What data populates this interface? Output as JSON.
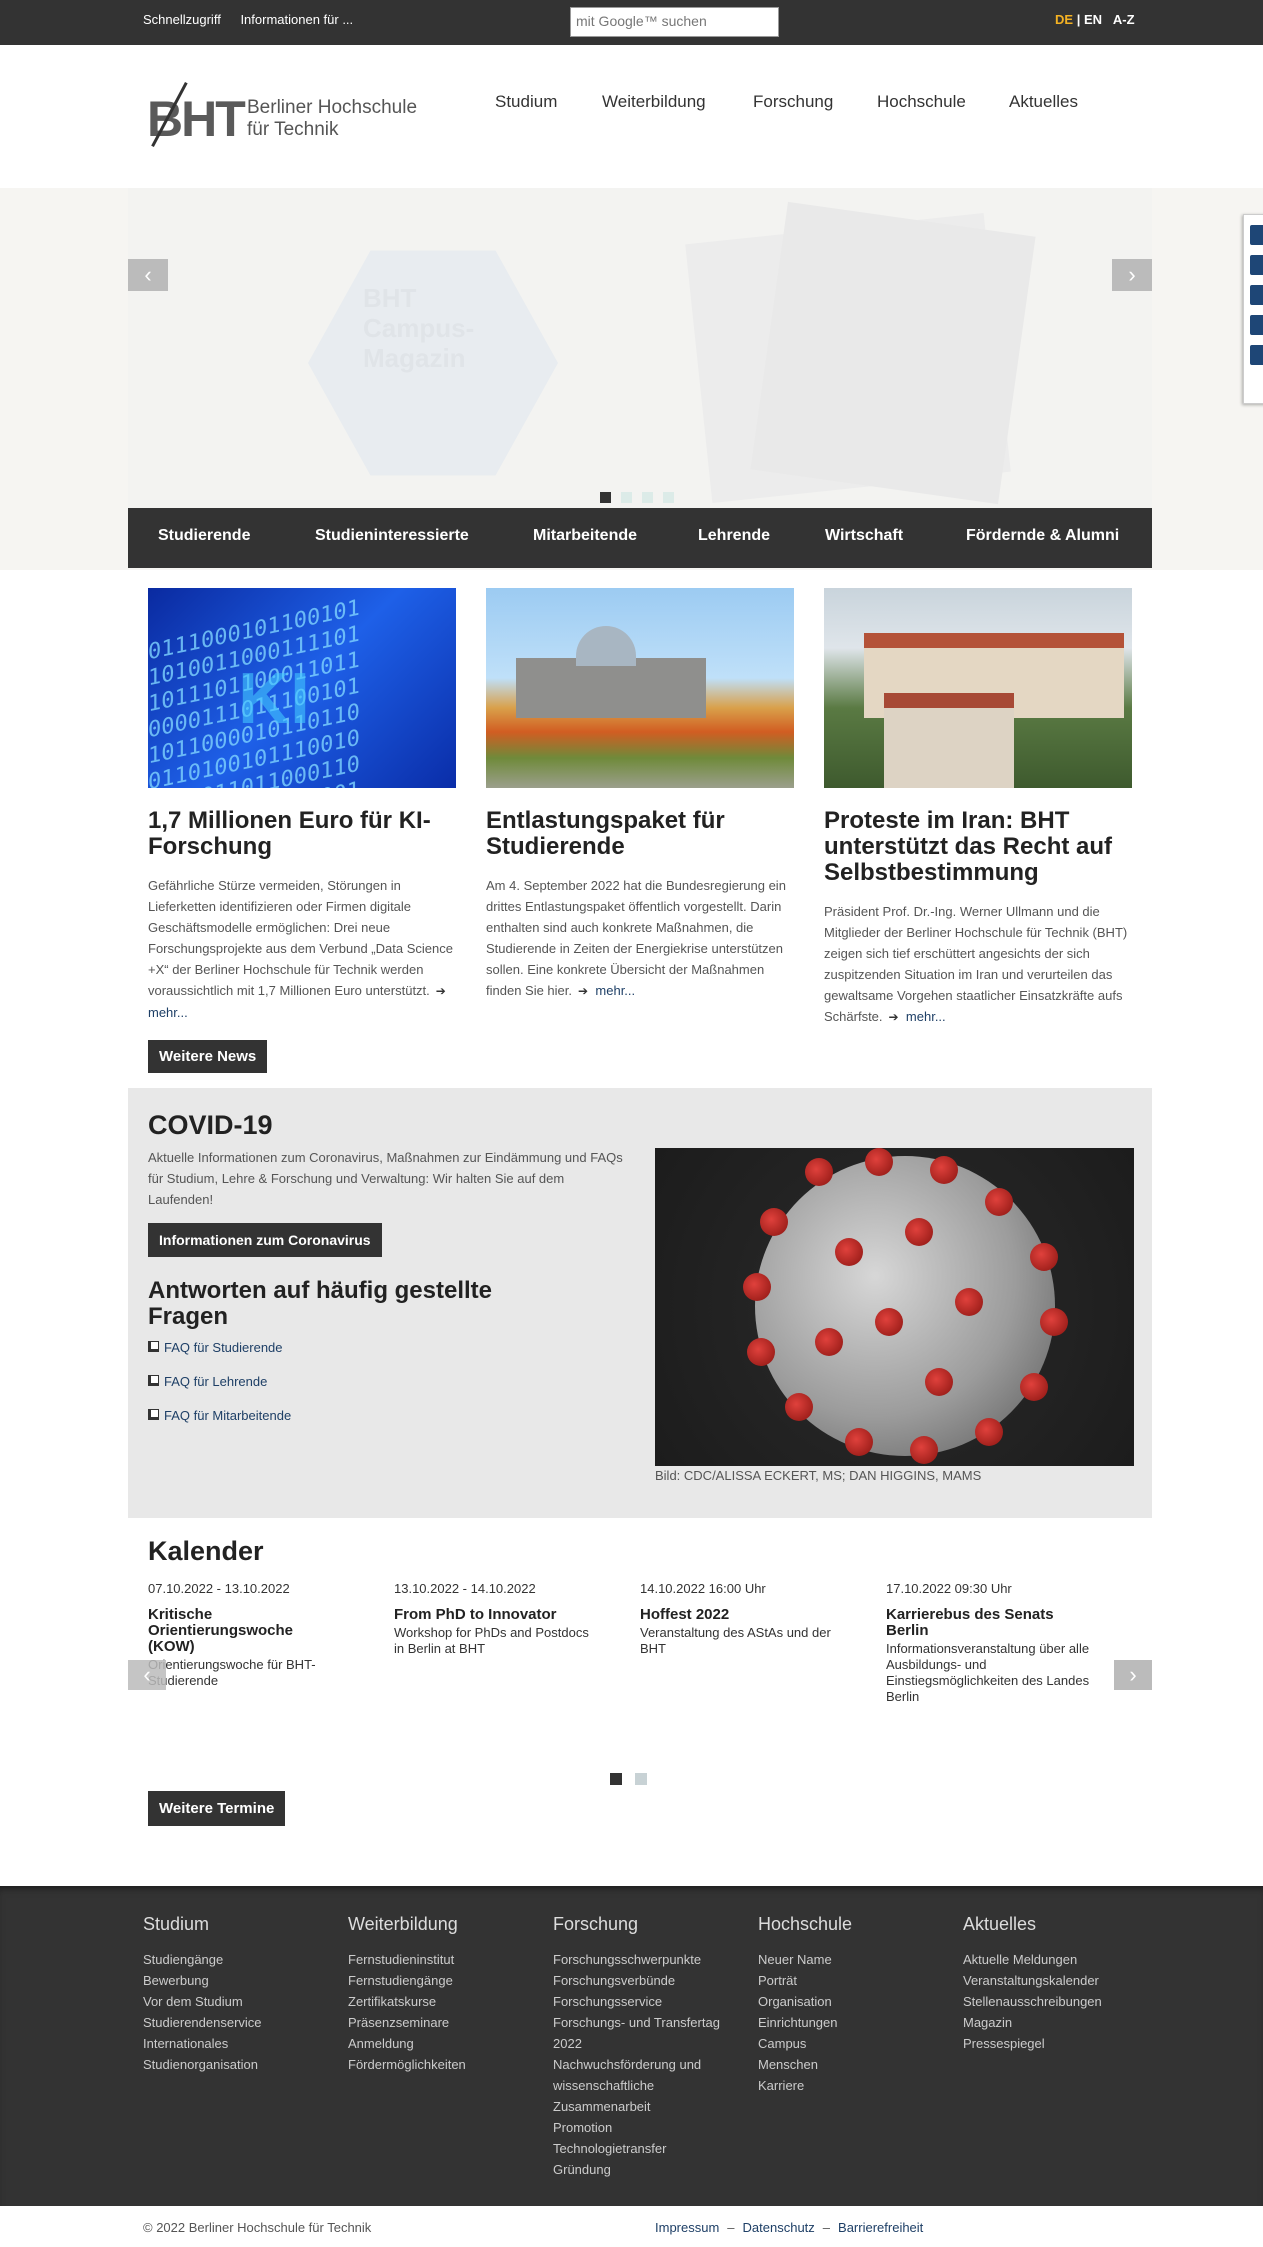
{
  "topbar": {
    "quick_access": "Schnellzugriff",
    "info_for": "Informationen für ...",
    "search_placeholder": "mit Google™ suchen",
    "lang_de": "DE",
    "lang_sep": "|",
    "lang_en": "EN",
    "az": "A-Z",
    "accent_color": "#f4b223"
  },
  "header": {
    "logo_mark": "BHT",
    "logo_line1": "Berliner Hochschule",
    "logo_line2": "für Technik",
    "nav": [
      "Studium",
      "Weiterbildung",
      "Forschung",
      "Hochschule",
      "Aktuelles"
    ]
  },
  "hero": {
    "slide_text": "BHT Campus-Magazin",
    "prev_icon": "‹",
    "next_icon": "›",
    "dot_count": 4,
    "active_dot": 1
  },
  "audience_nav": [
    "Studierende",
    "Studieninteressierte",
    "Mitarbeitende",
    "Lehrende",
    "Wirtschaft",
    "Fördernde & Alumni"
  ],
  "news": {
    "items": [
      {
        "title": "1,7 Millionen Euro für KI-Forschung",
        "text": "Gefährliche Stürze vermeiden, Störungen in Lieferketten identifizieren oder Firmen digitale Geschäftsmodelle ermöglichen: Drei neue Forschungsprojekte aus dem Verbund „Data Science +X“ der Berliner Hochschule für Technik werden voraussichtlich mit 1,7 Millionen Euro unterstützt.",
        "more": "mehr..."
      },
      {
        "title": "Entlastungspaket für Studierende",
        "text": "Am 4. September 2022 hat die Bundesregierung ein drittes Entlastungspaket öffentlich vorgestellt. Darin enthalten sind auch konkrete Maßnahmen, die Studierende in Zeiten der Energiekrise unterstützen sollen. Eine konkrete Übersicht der Maßnahmen finden Sie hier.",
        "more": "mehr..."
      },
      {
        "title": "Proteste im Iran: BHT unterstützt das Recht auf Selbstbestimmung",
        "text": "Präsident Prof. Dr.-Ing. Werner Ullmann und die Mitglieder der Berliner Hochschule für Technik (BHT) zeigen sich tief erschüttert angesichts der sich zuspitzenden Situation im Iran und verurteilen das gewaltsame Vorgehen staatlicher Einsatzkräfte aufs Schärfste.",
        "more": "mehr..."
      }
    ],
    "more_news_button": "Weitere News"
  },
  "covid": {
    "title": "COVID-19",
    "text": "Aktuelle Informationen zum Coronavirus, Maßnahmen zur Eindämmung und FAQs für Studium, Lehre & Forschung und Verwaltung: Wir halten Sie auf dem Laufenden!",
    "button": "Informationen zum Coronavirus",
    "faq_title": "Antworten auf häufig gestellte Fragen",
    "faq_links": [
      "FAQ für Studierende",
      "FAQ für Lehrende",
      "FAQ für Mitarbeitende"
    ],
    "image_credit": "Bild: CDC/ALISSA ECKERT, MS; DAN HIGGINS, MAMS"
  },
  "calendar": {
    "title": "Kalender",
    "events": [
      {
        "date": "07.10.2022 - 13.10.2022",
        "title": "Kritische Orientierungswoche (KOW)",
        "desc": "Orientierungswoche für BHT-Studierende"
      },
      {
        "date": "13.10.2022 - 14.10.2022",
        "title": "From PhD to Innovator",
        "desc": "Workshop for PhDs and Postdocs in Berlin at BHT"
      },
      {
        "date": "14.10.2022 16:00 Uhr",
        "title": "Hoffest 2022",
        "desc": "Veranstaltung des AStAs und der BHT"
      },
      {
        "date": "17.10.2022 09:30 Uhr",
        "title": "Karrierebus des Senats Berlin",
        "desc": "Informationsveranstaltung über alle Ausbildungs- und Einstiegsmöglichkeiten des Landes Berlin"
      }
    ],
    "more_button": "Weitere Termine",
    "prev_icon": "‹",
    "next_icon": "›"
  },
  "footer": {
    "columns": [
      {
        "title": "Studium",
        "links": [
          "Studiengänge",
          "Bewerbung",
          "Vor dem Studium",
          "Studierendenservice",
          "Internationales",
          "Studienorganisation"
        ]
      },
      {
        "title": "Weiterbildung",
        "links": [
          "Fernstudieninstitut",
          "Fernstudiengänge",
          "Zertifikatskurse",
          "Präsenzseminare",
          "Anmeldung",
          "Fördermöglichkeiten"
        ]
      },
      {
        "title": "Forschung",
        "links": [
          "Forschungsschwerpunkte",
          "Forschungsverbünde",
          "Forschungsservice",
          "Forschungs- und Transfertag 2022",
          "Nachwuchsförderung und wissenschaftliche Zusammenarbeit",
          "Promotion",
          "Technologietransfer",
          "Gründung"
        ]
      },
      {
        "title": "Hochschule",
        "links": [
          "Neuer Name",
          "Porträt",
          "Organisation",
          "Einrichtungen",
          "Campus",
          "Menschen",
          "Karriere"
        ]
      },
      {
        "title": "Aktuelles",
        "links": [
          "Aktuelle Meldungen",
          "Veranstaltungskalender",
          "Stellenausschreibungen",
          "Magazin",
          "Pressespiegel"
        ]
      }
    ],
    "copyright": "© 2022 Berliner Hochschule für Technik",
    "legal": [
      "Impressum",
      "Datenschutz",
      "Barrierefreiheit"
    ],
    "legal_sep": "–"
  }
}
